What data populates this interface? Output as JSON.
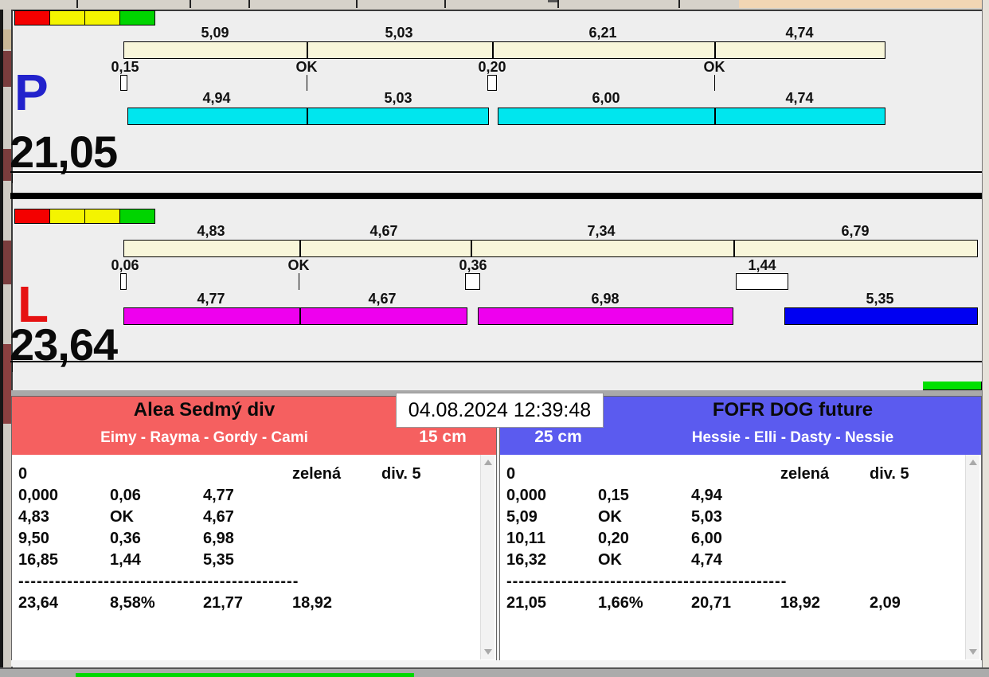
{
  "window": {
    "datetime": "04.08.2024 12:39:48",
    "colors": {
      "background": "#eeeeee",
      "cream_bar": "#f8f6da",
      "cyan_bar": "#00e6ee",
      "magenta_bar": "#ee00ee",
      "blue_bar": "#0000f2",
      "team_left_header": "#f56060",
      "team_right_header": "#5b5bef",
      "status_lights": [
        "#f40000",
        "#f4f400",
        "#f4f400",
        "#00d400"
      ]
    }
  },
  "lanes": [
    {
      "letter": "P",
      "letter_color": "#2222cc",
      "total": "21,05",
      "upper_segments": [
        "5,09",
        "5,03",
        "6,21",
        "4,74"
      ],
      "markers": [
        "0,15",
        "OK",
        "0,20",
        "OK"
      ],
      "lower_segments": [
        "4,94",
        "5,03",
        "6,00",
        "4,74"
      ]
    },
    {
      "letter": "L",
      "letter_color": "#e61212",
      "total": "23,64",
      "upper_segments": [
        "4,83",
        "4,67",
        "7,34",
        "6,79"
      ],
      "markers": [
        "0,06",
        "OK",
        "0,36",
        "1,44"
      ],
      "lower_segments": [
        "4,77",
        "4,67",
        "6,98",
        "5,35"
      ]
    }
  ],
  "teams": [
    {
      "name": "Alea Sedmý div",
      "dogs": "Eimy - Rayma - Gordy - Cami",
      "jump_height": "15 cm",
      "result": {
        "rows": [
          [
            "0",
            "",
            "",
            "zelená",
            "div. 5"
          ],
          [
            "0,000",
            "0,06",
            "4,77",
            "",
            ""
          ],
          [
            "4,83",
            "OK",
            "4,67",
            "",
            ""
          ],
          [
            "9,50",
            "0,36",
            "6,98",
            "",
            ""
          ],
          [
            "16,85",
            "1,44",
            "5,35",
            "",
            ""
          ]
        ],
        "separator": "----------------------------------------------",
        "totals": [
          "23,64",
          "8,58%",
          "21,77",
          "18,92",
          ""
        ]
      }
    },
    {
      "name": "FOFR DOG future",
      "dogs": "Hessie - Elli - Dasty - Nessie",
      "jump_height": "25 cm",
      "result": {
        "rows": [
          [
            "0",
            "",
            "",
            "zelená",
            "div. 5"
          ],
          [
            "0,000",
            "0,15",
            "4,94",
            "",
            ""
          ],
          [
            "5,09",
            "OK",
            "5,03",
            "",
            ""
          ],
          [
            "10,11",
            "0,20",
            "6,00",
            "",
            ""
          ],
          [
            "16,32",
            "OK",
            "4,74",
            "",
            ""
          ]
        ],
        "separator": "----------------------------------------------",
        "totals": [
          "21,05",
          "1,66%",
          "20,71",
          "18,92",
          "2,09"
        ]
      }
    }
  ]
}
